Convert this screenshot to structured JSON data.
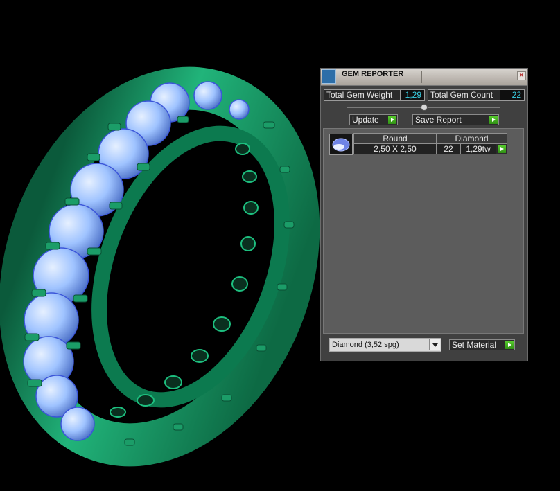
{
  "window": {
    "title": "GEM REPORTER",
    "close_icon": "×"
  },
  "stats": {
    "total_gem_weight_label": "Total Gem Weight",
    "total_gem_weight_value": "1,29",
    "total_gem_count_label": "Total Gem Count",
    "total_gem_count_value": "22"
  },
  "buttons": {
    "update": "Update",
    "save_report": "Save Report",
    "set_material": "Set Material"
  },
  "report": {
    "shape": "Round",
    "size": "2,50 X 2,50",
    "material": "Diamond",
    "count": "22",
    "weight": "1,29tw"
  },
  "material_select": {
    "value": "Diamond     (3,52 spg)"
  },
  "colors": {
    "accent_value": "#39d0e4",
    "button_arrow": "#45b524",
    "ring_green": "#1aa36b",
    "gem_blue": "#9fc3ff"
  }
}
